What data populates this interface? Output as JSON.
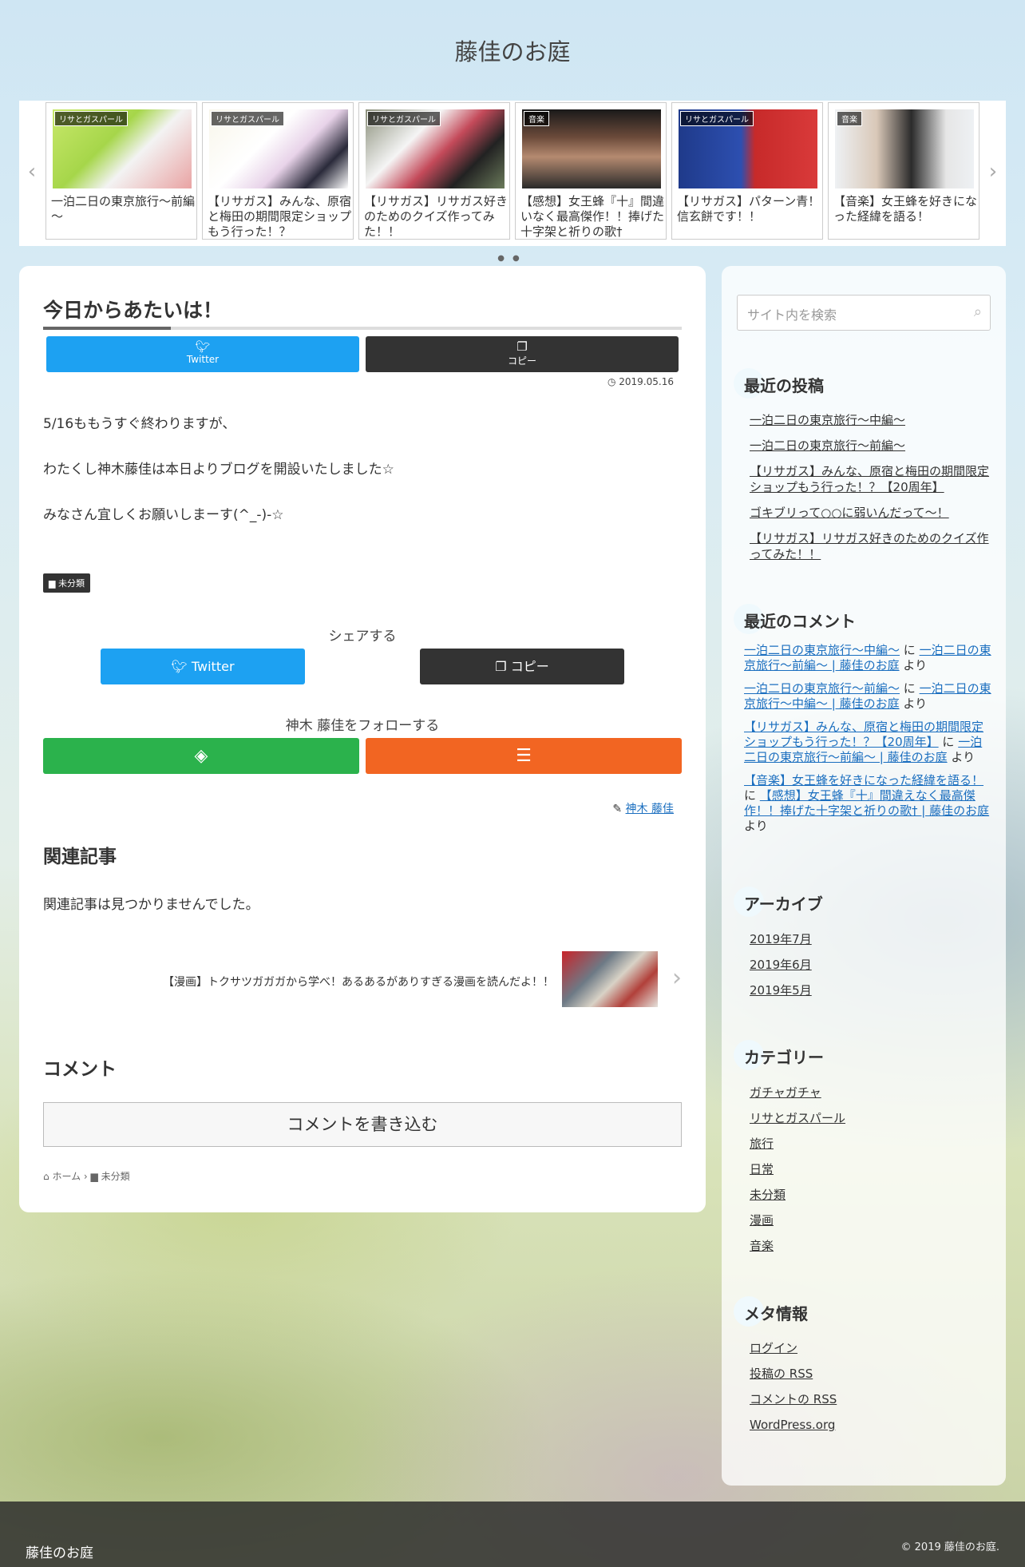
{
  "site": {
    "title": "藤佳のお庭"
  },
  "carousel": {
    "prev_icon": "chevron-left-icon",
    "next_icon": "chevron-right-icon",
    "cards": [
      {
        "category": "リサとガスパール",
        "title": "一泊二日の東京旅行～前編～"
      },
      {
        "category": "リサとガスパール",
        "title": "【リサガス】みんな、原宿と梅田の期間限定ショップもう行った！？"
      },
      {
        "category": "リサとガスパール",
        "title": "【リサガス】リサガス好きのためのクイズ作ってみた！！"
      },
      {
        "category": "音楽",
        "title": "【感想】女王蜂『十』間違いなく最高傑作！！捧げた十字架と祈りの歌†"
      },
      {
        "category": "リサとガスパール",
        "title": "【リサガス】パターン青！信玄餅です！！"
      },
      {
        "category": "音楽",
        "title": "【音楽】女王蜂を好きになった経緯を語る！"
      }
    ]
  },
  "post": {
    "title": "今日からあたいは！",
    "share_top": {
      "twitter": "Twitter",
      "copy": "コピー"
    },
    "date": "2019.05.16",
    "paragraphs": [
      "5/16ももうすぐ終わりますが、",
      "わたくし神木藤佳は本日よりブログを開設いたしました☆",
      "みなさん宜しくお願いしまーす(^_-)-☆"
    ],
    "tag": "未分類",
    "share_heading": "シェアする",
    "share_bottom": {
      "twitter": "Twitter",
      "copy": "コピー"
    },
    "follow_heading": "神木 藤佳をフォローする",
    "author": "神木 藤佳",
    "related_title": "関連記事",
    "related_none": "関連記事は見つかりませんでした。",
    "next_post": "【漫画】トクサツガガガから学べ！あるあるがありすぎる漫画を読んだよ！！",
    "comment_title": "コメント",
    "comment_button": "コメントを書き込む",
    "breadcrumb": {
      "home": "ホーム",
      "category": "未分類"
    }
  },
  "sidebar": {
    "search_placeholder": "サイト内を検索",
    "recent_posts_title": "最近の投稿",
    "recent_posts": [
      "一泊二日の東京旅行～中編～",
      "一泊二日の東京旅行～前編～",
      "【リサガス】みんな、原宿と梅田の期間限定ショップもう行った！？【20周年】",
      "ゴキブリって○○に弱いんだって～！",
      "【リサガス】リサガス好きのためのクイズ作ってみた！！"
    ],
    "recent_comments_title": "最近のコメント",
    "recent_comments": [
      {
        "author": "一泊二日の東京旅行～中編～",
        "on": "に",
        "post": "一泊二日の東京旅行～前編～ | 藤佳のお庭",
        "suffix": "より"
      },
      {
        "author": "一泊二日の東京旅行～前編～",
        "on": "に",
        "post": "一泊二日の東京旅行～中編～ | 藤佳のお庭",
        "suffix": "より"
      },
      {
        "author": "【リサガス】みんな、原宿と梅田の期間限定ショップもう行った！？【20周年】",
        "on": "に",
        "post": "一泊二日の東京旅行～前編～ | 藤佳のお庭",
        "suffix": "より"
      },
      {
        "author": "【音楽】女王蜂を好きになった経緯を語る！",
        "on": "に",
        "post": "【感想】女王蜂『十』間違えなく最高傑作！！捧げた十字架と祈りの歌† | 藤佳のお庭",
        "suffix": "より"
      }
    ],
    "archives_title": "アーカイブ",
    "archives": [
      "2019年7月",
      "2019年6月",
      "2019年5月"
    ],
    "categories_title": "カテゴリー",
    "categories": [
      "ガチャガチャ",
      "リサとガスパール",
      "旅行",
      "日常",
      "未分類",
      "漫画",
      "音楽"
    ],
    "meta_title": "メタ情報",
    "meta": [
      "ログイン",
      "投稿の RSS",
      "コメントの RSS",
      "WordPress.org"
    ]
  },
  "footer": {
    "title": "藤佳のお庭",
    "copyright": "© 2019 藤佳のお庭."
  }
}
